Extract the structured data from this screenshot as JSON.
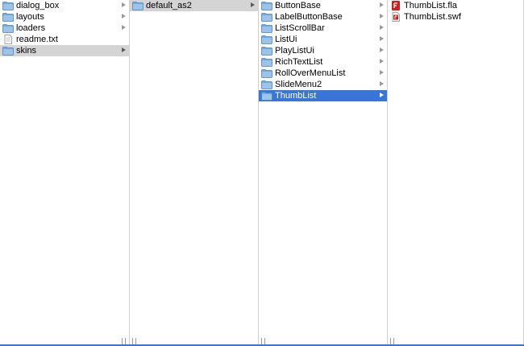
{
  "columns": [
    {
      "items": [
        {
          "label": "dialog_box",
          "icon": "folder-icon",
          "has_children": true
        },
        {
          "label": "layouts",
          "icon": "folder-icon",
          "has_children": true
        },
        {
          "label": "loaders",
          "icon": "folder-icon",
          "has_children": true
        },
        {
          "label": "readme.txt",
          "icon": "text-file-icon",
          "has_children": false
        },
        {
          "label": "skins",
          "icon": "folder-icon",
          "has_children": true,
          "selected": "inactive"
        }
      ]
    },
    {
      "items": [
        {
          "label": "default_as2",
          "icon": "folder-icon",
          "has_children": true,
          "selected": "inactive"
        }
      ]
    },
    {
      "items": [
        {
          "label": "ButtonBase",
          "icon": "folder-icon",
          "has_children": true
        },
        {
          "label": "LabelButtonBase",
          "icon": "folder-icon",
          "has_children": true
        },
        {
          "label": "ListScrollBar",
          "icon": "folder-icon",
          "has_children": true
        },
        {
          "label": "ListUi",
          "icon": "folder-icon",
          "has_children": true
        },
        {
          "label": "PlayListUi",
          "icon": "folder-icon",
          "has_children": true
        },
        {
          "label": "RichTextList",
          "icon": "folder-icon",
          "has_children": true
        },
        {
          "label": "RollOverMenuList",
          "icon": "folder-icon",
          "has_children": true
        },
        {
          "label": "SlideMenu2",
          "icon": "folder-icon",
          "has_children": true
        },
        {
          "label": "ThumbList",
          "icon": "folder-icon",
          "has_children": true,
          "selected": "active"
        }
      ]
    },
    {
      "items": [
        {
          "label": "ThumbList.fla",
          "icon": "fla-file-icon",
          "has_children": false
        },
        {
          "label": "ThumbList.swf",
          "icon": "swf-file-icon",
          "has_children": false
        }
      ]
    }
  ],
  "colors": {
    "selection_active": "#3875d7",
    "selection_inactive": "#d4d4d4",
    "folder_blue": "#74a9dc",
    "flash_red": "#cc1f1f"
  }
}
